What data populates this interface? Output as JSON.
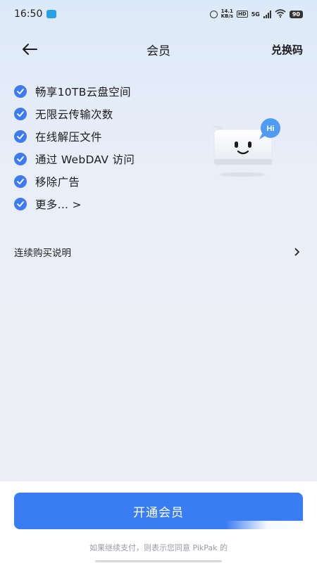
{
  "status_bar": {
    "time": "16:50",
    "net_speed_value": "14.1",
    "net_speed_unit": "KB/s",
    "hd_label": "HD",
    "network_type": "5G",
    "battery": "90"
  },
  "header": {
    "title": "会员",
    "redeem_label": "兑换码"
  },
  "benefits": [
    {
      "label": "畅享10TB云盘空间"
    },
    {
      "label": "无限云传输次数"
    },
    {
      "label": "在线解压文件"
    },
    {
      "label": "通过 WebDAV 访问"
    },
    {
      "label": "移除广告"
    },
    {
      "label": "更多... >"
    }
  ],
  "mascot": {
    "bubble_text": "Hi"
  },
  "purchase_info": {
    "label": "连续购买说明"
  },
  "bottom": {
    "subscribe_label": "开通会员",
    "agreement_text": "如果继续支付，则表示您同意 PikPak 的"
  },
  "colors": {
    "accent": "#3a7cf2",
    "check": "#3e7bf0",
    "bubble": "#4f9cf5"
  }
}
